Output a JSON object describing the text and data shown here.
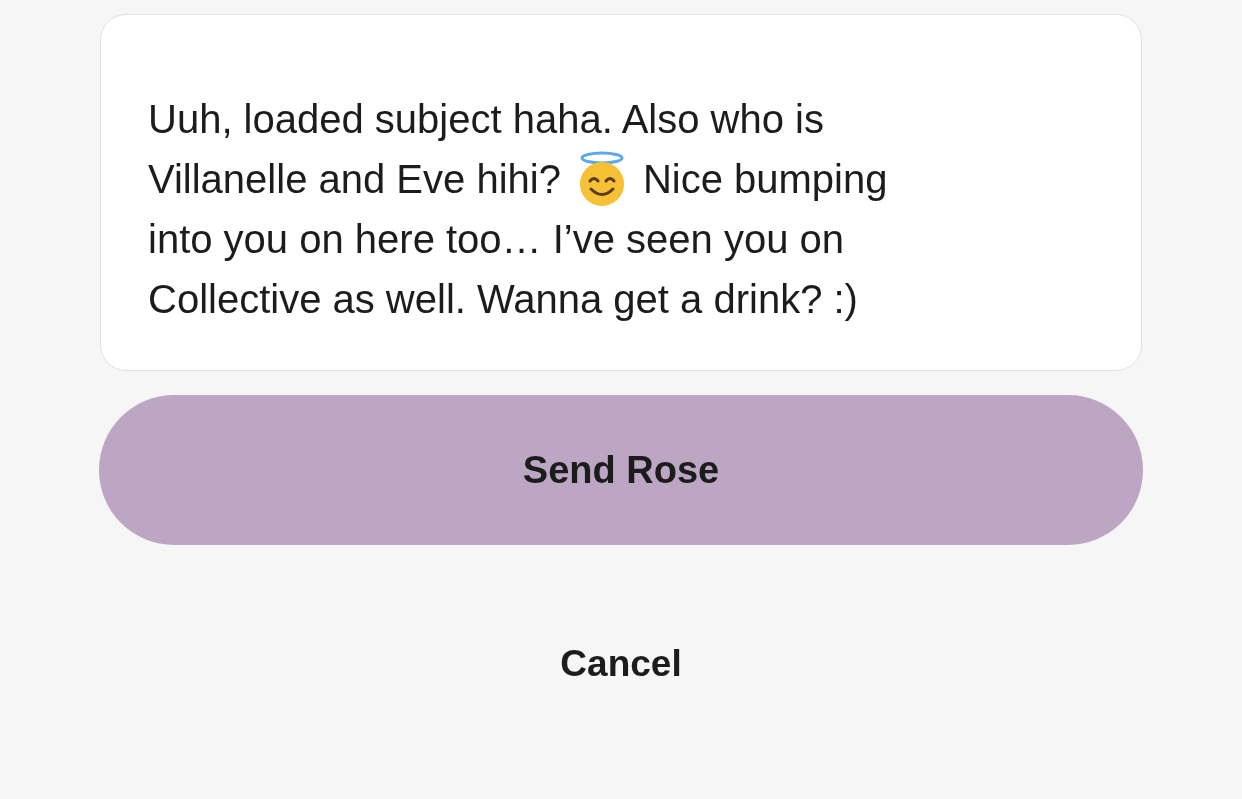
{
  "message": {
    "lines": [
      {
        "parts": [
          {
            "kind": "text",
            "text": "Uuh, loaded subject haha. Also who is"
          }
        ]
      },
      {
        "parts": [
          {
            "kind": "text",
            "text": "Villanelle and Eve hihi?"
          },
          {
            "kind": "emoji"
          },
          {
            "kind": "text",
            "text": "Nice bumping"
          }
        ]
      },
      {
        "parts": [
          {
            "kind": "text",
            "text": "into you on here too… I’ve seen you on"
          }
        ]
      },
      {
        "parts": [
          {
            "kind": "text",
            "text": "Collective as well. Wanna get a drink? :)"
          }
        ]
      }
    ]
  },
  "buttons": [
    {
      "label": "Send Rose",
      "kind": "primary"
    },
    {
      "label": "Cancel",
      "kind": "plain"
    }
  ]
}
